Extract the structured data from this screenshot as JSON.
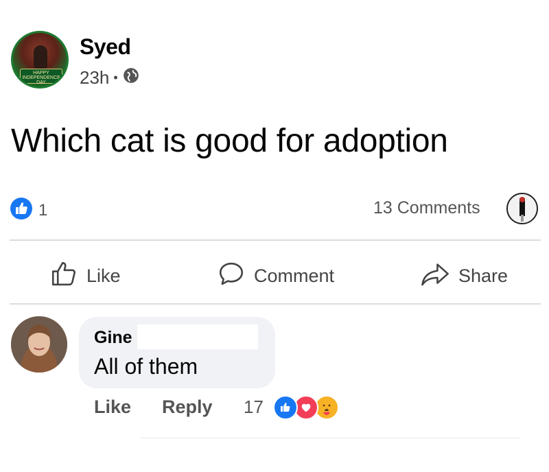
{
  "post": {
    "author": "Syed",
    "time": "23h",
    "separator": "•",
    "text": "Which cat is good for adoption",
    "avatar_badge": "HAPPY INDEPENDENCE DAY",
    "like_count": "1",
    "comments_count": "13 Comments"
  },
  "actions": {
    "like": "Like",
    "comment": "Comment",
    "share": "Share"
  },
  "comment": {
    "author": "Gine",
    "text": "All of them",
    "like_label": "Like",
    "reply_label": "Reply",
    "reaction_count": "17"
  },
  "colors": {
    "like_blue": "#1877f2",
    "love_red": "#f33e58",
    "care_yellow": "#f7b125",
    "bubble_bg": "#f0f2f5"
  },
  "icons": [
    "globe-icon",
    "like-reaction-icon",
    "thumbs-up-icon",
    "comment-icon",
    "share-icon",
    "love-reaction-icon",
    "care-reaction-icon"
  ]
}
